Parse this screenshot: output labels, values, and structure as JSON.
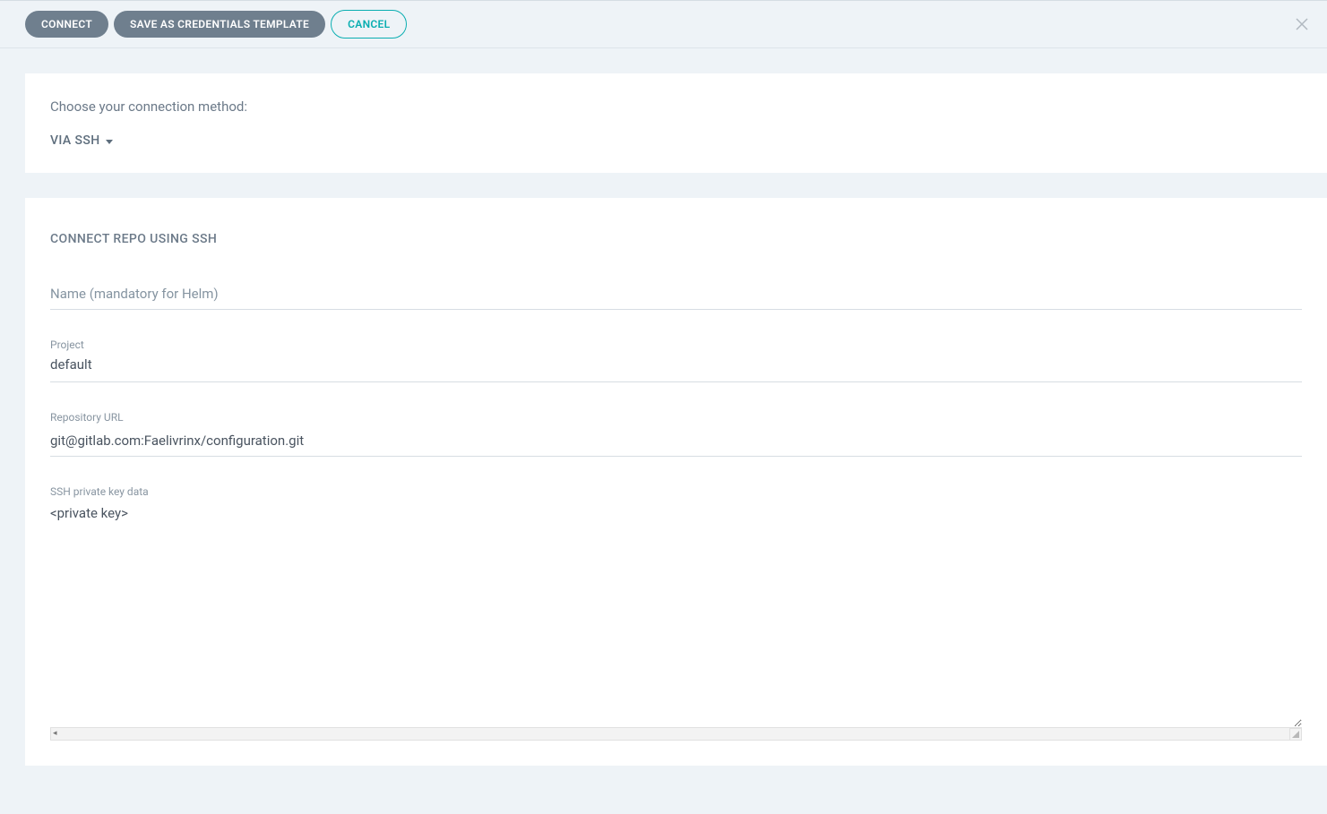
{
  "header": {
    "connect_label": "CONNECT",
    "save_template_label": "SAVE AS CREDENTIALS TEMPLATE",
    "cancel_label": "CANCEL"
  },
  "method": {
    "prompt": "Choose your connection method:",
    "selected": "VIA SSH"
  },
  "form": {
    "title": "CONNECT REPO USING SSH",
    "name": {
      "placeholder": "Name (mandatory for Helm)",
      "value": ""
    },
    "project": {
      "label": "Project",
      "value": "default"
    },
    "repo_url": {
      "label": "Repository URL",
      "value": "git@gitlab.com:Faelivrinx/configuration.git"
    },
    "ssh_key": {
      "label": "SSH private key data",
      "value": "<private key>"
    }
  }
}
